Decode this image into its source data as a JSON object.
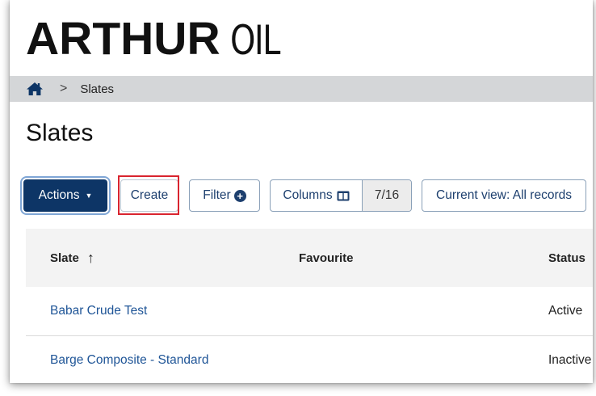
{
  "logo": {
    "bold": "ARTHUR",
    "light": "OIL"
  },
  "breadcrumb": {
    "home_icon": "home-icon",
    "separator": ">",
    "current": "Slates"
  },
  "page_title": "Slates",
  "toolbar": {
    "actions_label": "Actions",
    "create_label": "Create",
    "filter_label": "Filter",
    "columns_label": "Columns",
    "columns_count": "7/16",
    "view_label": "Current view: All records"
  },
  "table": {
    "headers": {
      "slate": "Slate",
      "favourite": "Favourite",
      "status": "Status"
    },
    "sort_icon": "arrow-up-icon",
    "rows": [
      {
        "slate": "Babar Crude Test",
        "status": "Active"
      },
      {
        "slate": "Barge Composite - Standard",
        "status": "Inactive"
      }
    ]
  },
  "colors": {
    "primary": "#0d3566",
    "link": "#1f5597",
    "highlight": "#d9242f",
    "breadcrumb_bg": "#d4d6d8"
  }
}
